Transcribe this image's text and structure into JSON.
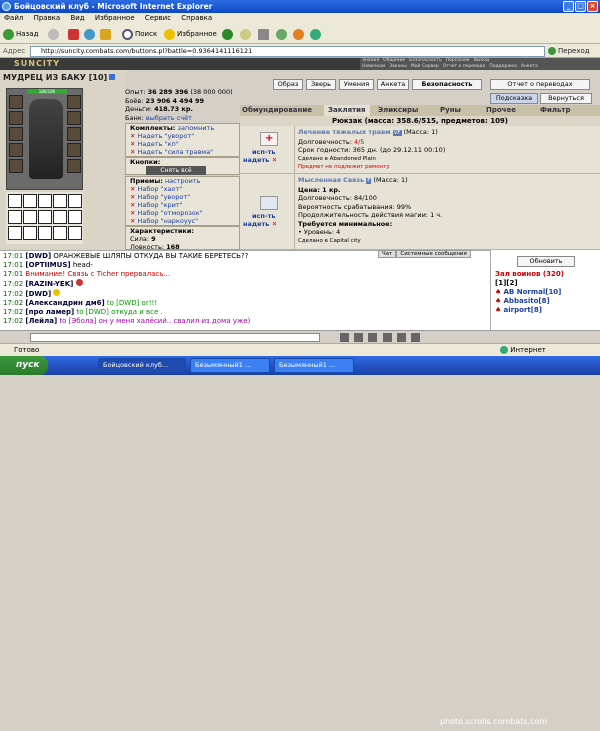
{
  "window": {
    "title": "Бойцовский клуб - Microsoft Internet Explorer"
  },
  "menu": [
    "Файл",
    "Правка",
    "Вид",
    "Избранное",
    "Сервис",
    "Справка"
  ],
  "toolbar": {
    "back": "Назад",
    "search": "Поиск",
    "favorites": "Избранное"
  },
  "address": {
    "label": "Адрес",
    "url": "http://suncity.combats.com/buttons.pl?battle=0.9364141116121",
    "go": "Переход"
  },
  "game": {
    "logo": "SUNCITY",
    "top_links": [
      "Знания",
      "Общение",
      "Безопасность",
      "Персонаж",
      "Выход",
      "Новичкам",
      "Законы",
      "Мой Сервер",
      "Отчет о переводе",
      "Поддержка",
      "Анкета"
    ]
  },
  "character": {
    "name": "МУДРЕЦ ИЗ БАКУ",
    "level": "[10]",
    "hp": "186/186",
    "exp_label": "Опыт:",
    "exp": "36 289 396",
    "exp_next": "(38 000 000)",
    "battles_label": "Боёв:",
    "battles": "23 906",
    "wins": "4 494",
    "losses": "99",
    "money_label": "Деньги:",
    "money": "418.73 кр.",
    "bank_label": "Банк:",
    "bank": "выбрать счёт"
  },
  "sets": {
    "title": "Комплекты:",
    "action": "запомнить",
    "items": [
      "Надеть \"уворот\"",
      "Надеть \"кп\"",
      "Надеть \"сила травма\""
    ]
  },
  "buttons_section": {
    "title": "Кнопки:",
    "undress": "Снять всё"
  },
  "tricks": {
    "title": "Приемы:",
    "action": "настроить",
    "items": [
      "Набор \"хаот\"",
      "Набор \"уворот\"",
      "Набор \"крит\"",
      "Набор \"отморозок\"",
      "Набор \"наркоуус\""
    ]
  },
  "characteristics": {
    "title": "Характеристики:",
    "strength_label": "Сила:",
    "strength": "9",
    "agility_label": "Ловкость:",
    "agility": "168"
  },
  "top_buttons": [
    "Образ",
    "Зверь",
    "Умения",
    "Анкета",
    "Безопасность",
    "Отчет о переводах",
    "Подсказка",
    "Вернуться"
  ],
  "tabs": [
    "Обмундирование",
    "Заклятия",
    "Эликсиры",
    "Руны",
    "Прочее",
    "Фильтр"
  ],
  "backpack": "Рюкзак (масса: 358.6/515, предметов: 109)",
  "items": [
    {
      "name": "Лечение тяжелых травм",
      "badge": "VF",
      "mass": "(Масса: 1)",
      "use": "исп-ть",
      "wear": "надеть",
      "durability_label": "Долговечность:",
      "durability": "4/5",
      "expiry_label": "Срок годности:",
      "expiry": "365 дн. (до 29.12.11 00:10)",
      "made": "Сделано в Abandoned Plain",
      "note": "Предмет не подлежит ремонту"
    },
    {
      "name": "Мысленная Связь",
      "badge": "F",
      "mass": "(Масса: 1)",
      "use": "исп-ть",
      "wear": "надеть",
      "price": "Цена: 1 кр.",
      "durability_label": "Долговечность:",
      "durability": "84/100",
      "chance": "Вероятность срабатывания: 99%",
      "duration": "Продолжительность действия магии: 1 ч.",
      "req_title": "Требуется минимальное:",
      "req_level": "• Уровень: 4",
      "made": "Сделано в Capital city"
    }
  ],
  "chat": {
    "tabs": [
      "Чат",
      "Системные сообщения"
    ],
    "lines": [
      {
        "time": "17:01",
        "nick": "[DWD]",
        "text": "ОРАНЖЕВЫЕ ШЛЯПЫ ОТКУДА ВЫ ТАКИЕ БЕРЕТЕСЬ??"
      },
      {
        "time": "17:01",
        "nick": "[OPTIIMUS]",
        "text": "head-"
      },
      {
        "time": "17:01",
        "nick": "",
        "text": "Внимание! Связь с Ticher прервалась..."
      },
      {
        "time": "17:02",
        "nick": "[RAZIN-YEK]",
        "text": ""
      },
      {
        "time": "17:02",
        "nick": "[DWD]",
        "text": ""
      },
      {
        "time": "17:02",
        "nick": "[Александрин дм6]",
        "text": "to [DWD] or!!!"
      },
      {
        "time": "17:02",
        "nick": "[про ламер]",
        "text": "to [DWD] откуда и все ."
      },
      {
        "time": "17:02",
        "nick": "[Лейла]",
        "text": "to [Эбола] он у меня халёсий.. свалил из дома уже)"
      }
    ]
  },
  "room": {
    "refresh": "Обновить",
    "title": "Зал воинов (320)",
    "pages": "[1][2]",
    "players": [
      "AB Normal[10]",
      "Abbasito[8]",
      "airport[8]"
    ]
  },
  "status": {
    "left": "Готово",
    "zone": "Интернет"
  },
  "taskbar": {
    "start": "пуск",
    "tasks": [
      "Бойцовский клуб...",
      "Безымянный1 ...",
      "Безымянный1 ..."
    ]
  },
  "watermark": "photo.scrolls.combats.com"
}
